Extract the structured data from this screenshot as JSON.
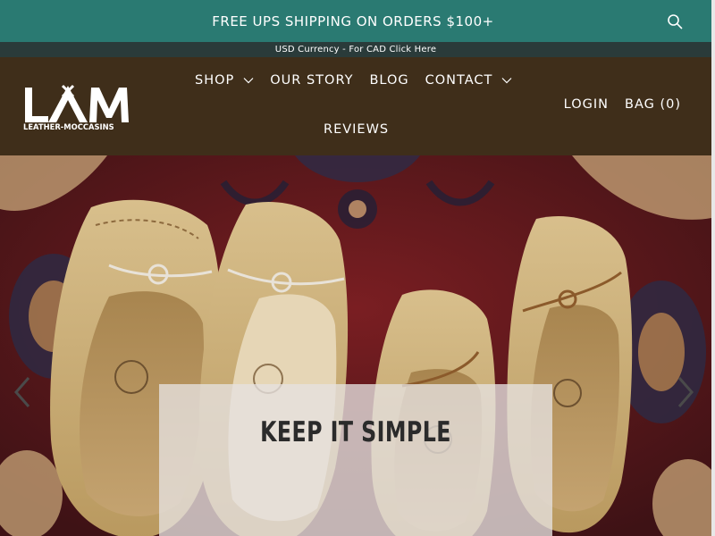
{
  "announcement": {
    "text": "FREE UPS SHIPPING ON ORDERS $100+"
  },
  "currency_bar": {
    "text": "USD Currency - For CAD Click Here"
  },
  "logo": {
    "wordmark": "LAM",
    "subtitle": "LEATHER-MOCCASINS"
  },
  "nav": {
    "items": [
      {
        "label": "SHOP",
        "has_dropdown": true
      },
      {
        "label": "OUR STORY",
        "has_dropdown": false
      },
      {
        "label": "BLOG",
        "has_dropdown": false
      },
      {
        "label": "CONTACT",
        "has_dropdown": true
      },
      {
        "label": "REVIEWS",
        "has_dropdown": false
      }
    ]
  },
  "account": {
    "login_label": "LOGIN",
    "bag_label": "BAG (0)"
  },
  "hero": {
    "caption": "KEEP IT SIMPLE"
  },
  "icons": {
    "search": "search-icon",
    "chevron": "chevron-down-icon",
    "prev": "chevron-left-icon",
    "next": "chevron-right-icon"
  },
  "colors": {
    "announcement_bg": "#2a7a72",
    "currency_bg": "#2a3b3a",
    "header_bg": "#3f2e1a",
    "rug_red": "#6b1a1f",
    "moccasin_tan": "#c9ac78"
  }
}
